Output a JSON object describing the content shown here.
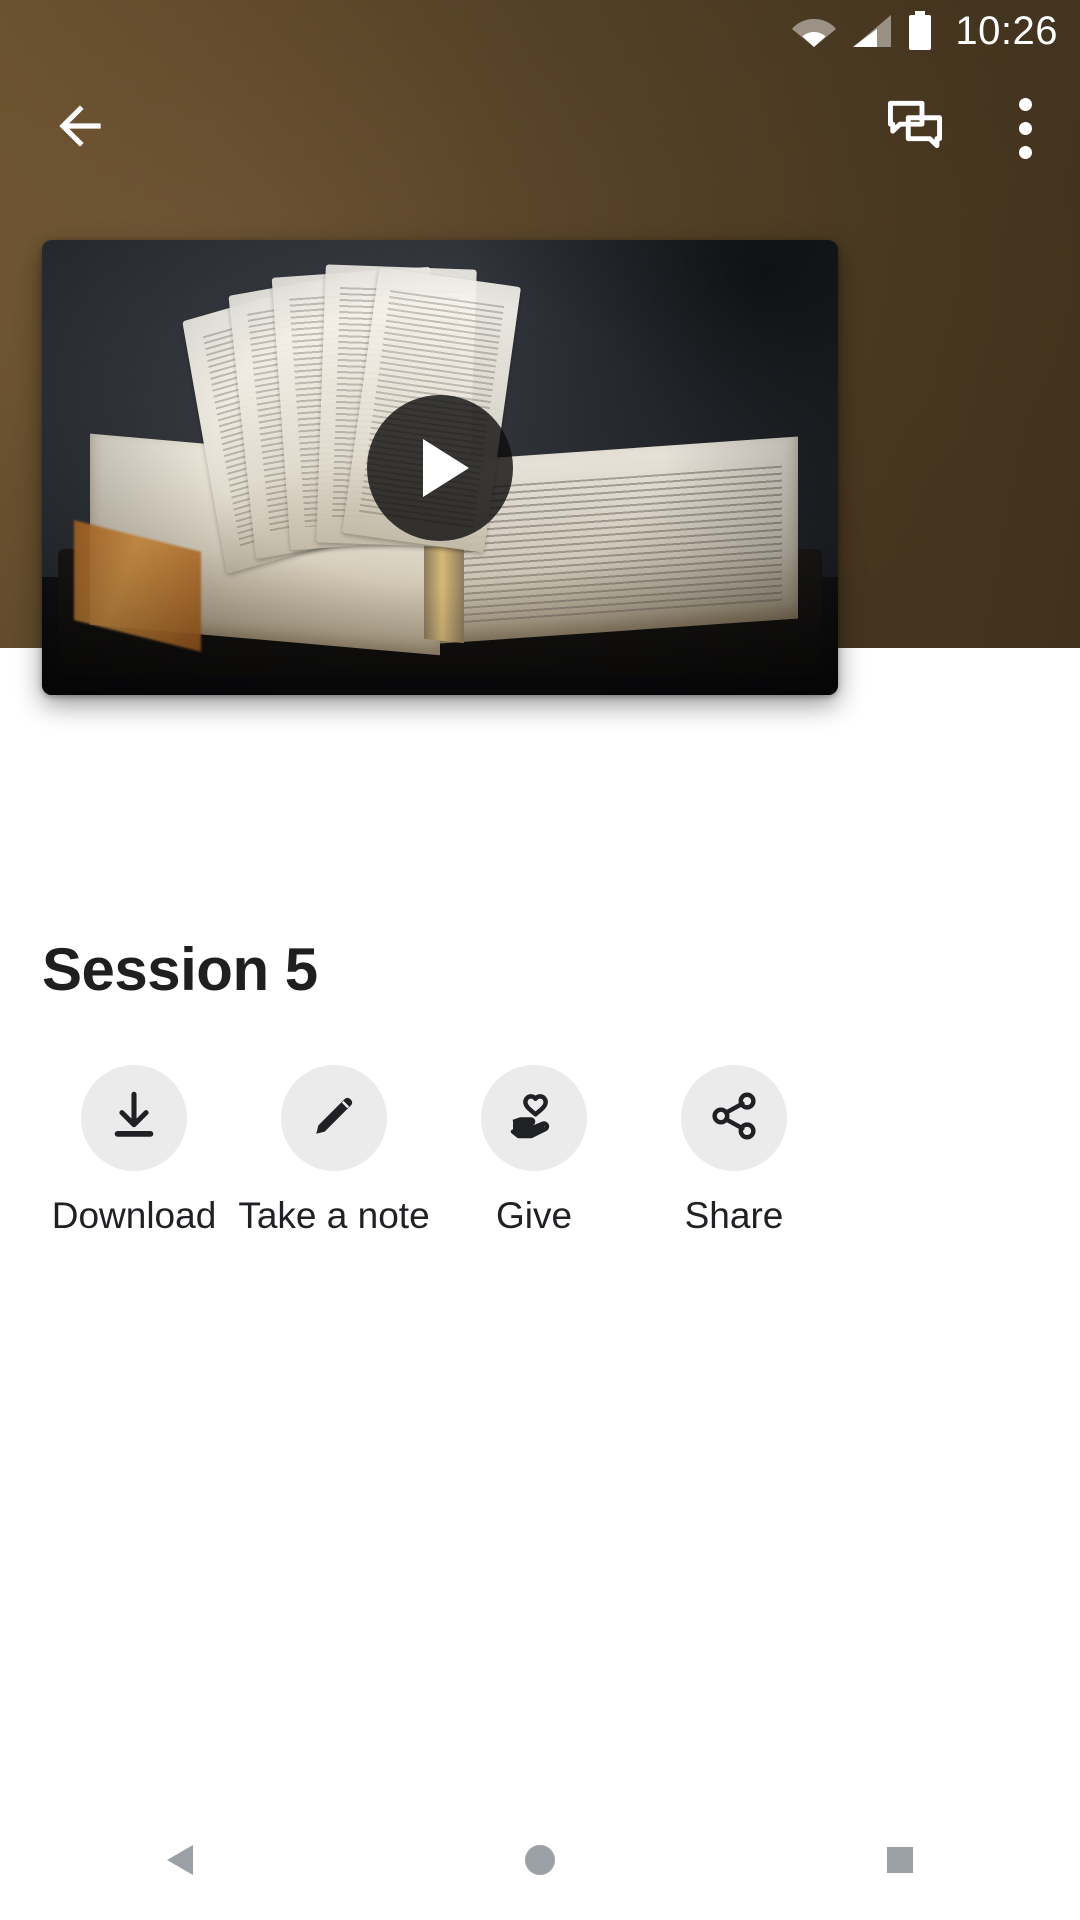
{
  "status_bar": {
    "time": "10:26",
    "icons": [
      "wifi-icon",
      "cellular-signal-icon",
      "battery-icon"
    ],
    "text_color": "#ffffff"
  },
  "app_bar": {
    "back_icon": "back-arrow-icon",
    "chat_icon": "chat-bubbles-icon",
    "overflow_icon": "more-vertical-icon",
    "background_color": "#584327"
  },
  "video": {
    "thumbnail_alt": "open bible with fanned pages",
    "play_icon": "play-triangle-icon",
    "overlay_color": "#0c0c0c"
  },
  "main": {
    "title": "Session 5",
    "title_color": "#1f1f1f"
  },
  "actions": [
    {
      "label": "Download",
      "icon": "download-icon"
    },
    {
      "label": "Take a note",
      "icon": "pencil-icon"
    },
    {
      "label": "Give",
      "icon": "hand-heart-icon"
    },
    {
      "label": "Share",
      "icon": "share-nodes-icon"
    }
  ],
  "action_style": {
    "circle_color": "#ebebeb",
    "icon_color": "#202124",
    "label_color": "#202124"
  },
  "nav_bar": {
    "back_icon": "nav-back-triangle-icon",
    "home_icon": "nav-home-circle-icon",
    "recents_icon": "nav-recents-square-icon",
    "icon_color": "#9aa0a6",
    "background_color": "#ffffff"
  }
}
